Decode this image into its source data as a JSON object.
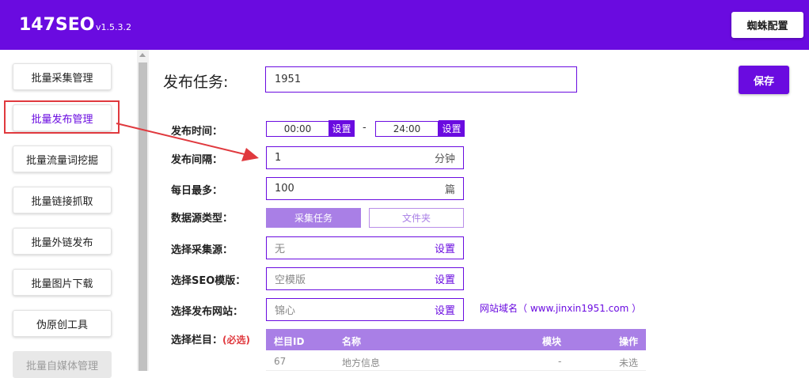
{
  "header": {
    "app_name": "147SEO",
    "version": "v1.5.3.2",
    "spider_config_button": "蜘蛛配置"
  },
  "sidebar": {
    "items": [
      {
        "label": "批量采集管理"
      },
      {
        "label": "批量发布管理"
      },
      {
        "label": "批量流量词挖掘"
      },
      {
        "label": "批量链接抓取"
      },
      {
        "label": "批量外链发布"
      },
      {
        "label": "批量图片下载"
      },
      {
        "label": "伪原创工具"
      },
      {
        "label": "批量自媒体管理"
      }
    ]
  },
  "form": {
    "task_label": "发布任务:",
    "task_value": "1951",
    "save_button": "保存",
    "publish_time": {
      "label": "发布时间：",
      "start": "00:00",
      "end": "24:00",
      "set_label": "设置",
      "separator": "-"
    },
    "interval": {
      "label": "发布间隔：",
      "value": "1",
      "unit": "分钟"
    },
    "daily_max": {
      "label": "每日最多：",
      "value": "100",
      "unit": "篇"
    },
    "data_source": {
      "label": "数据源类型：",
      "options": [
        "采集任务",
        "文件夹"
      ],
      "selected": "采集任务"
    },
    "collect_source": {
      "label": "选择采集源：",
      "value": "无",
      "action": "设置"
    },
    "seo_template": {
      "label": "选择SEO模版：",
      "value": "空模版",
      "action": "设置"
    },
    "publish_site": {
      "label": "选择发布网站：",
      "value": "锦心",
      "action": "设置",
      "domain_note": "网站域名（ www.jinxin1951.com ）"
    },
    "column": {
      "label": "选择栏目：",
      "required": "(必选)"
    }
  },
  "column_table": {
    "headers": [
      "栏目ID",
      "名称",
      "模块",
      "操作"
    ],
    "rows": [
      {
        "id": "67",
        "name": "地方信息",
        "module": "-",
        "action": "未选"
      }
    ]
  },
  "colors": {
    "accent": "#6a0be0",
    "highlight": "#e0393e",
    "table_header": "#a97fe6"
  }
}
